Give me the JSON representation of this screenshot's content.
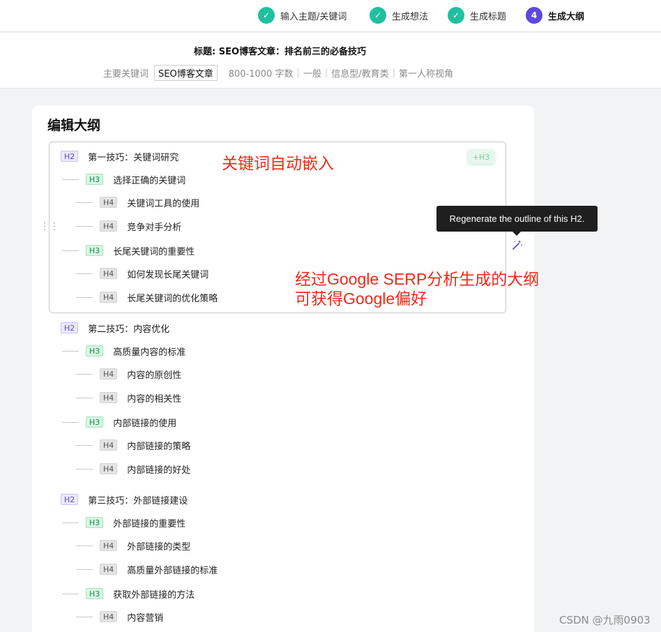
{
  "stepper": {
    "steps": [
      {
        "label": "输入主题/关键词",
        "status": "done",
        "mark": "✓"
      },
      {
        "label": "生成想法",
        "status": "done",
        "mark": "✓"
      },
      {
        "label": "生成标题",
        "status": "done",
        "mark": "✓"
      },
      {
        "label": "生成大纲",
        "status": "active",
        "mark": "4"
      }
    ]
  },
  "info": {
    "title": "标题: SEO博客文章：排名前三的必备技巧",
    "keyword_label": "主要关键词",
    "keyword_value": "SEO博客文章",
    "word_count": "800-1000 字数",
    "tone": "一般",
    "type": "信息型/教育类",
    "perspective": "第一人称视角"
  },
  "card": {
    "title": "编辑大纲",
    "add_h3_label": "+H3",
    "drag_handle": "⋮⋮",
    "tooltip": "Regenerate the outline of this H2."
  },
  "outline": [
    {
      "level": "H2",
      "text": "第一技巧：关键词研究"
    },
    {
      "level": "H3",
      "text": "选择正确的关键词"
    },
    {
      "level": "H4",
      "text": "关键词工具的使用"
    },
    {
      "level": "H4",
      "text": "竞争对手分析"
    },
    {
      "level": "H3",
      "text": "长尾关键词的重要性"
    },
    {
      "level": "H4",
      "text": "如何发现长尾关键词"
    },
    {
      "level": "H4",
      "text": "长尾关键词的优化策略"
    },
    {
      "level": "H2",
      "text": "第二技巧：内容优化"
    },
    {
      "level": "H3",
      "text": "高质量内容的标准"
    },
    {
      "level": "H4",
      "text": "内容的原创性"
    },
    {
      "level": "H4",
      "text": "内容的相关性"
    },
    {
      "level": "H3",
      "text": "内部链接的使用"
    },
    {
      "level": "H4",
      "text": "内部链接的策略"
    },
    {
      "level": "H4",
      "text": "内部链接的好处"
    },
    {
      "level": "H2",
      "text": "第三技巧：外部链接建设"
    },
    {
      "level": "H3",
      "text": "外部链接的重要性"
    },
    {
      "level": "H4",
      "text": "外部链接的类型"
    },
    {
      "level": "H4",
      "text": "高质量外部链接的标准"
    },
    {
      "level": "H3",
      "text": "获取外部链接的方法"
    },
    {
      "level": "H4",
      "text": "内容营销"
    }
  ],
  "annotations": {
    "note1": "关键词自动嵌入",
    "note2_line1": "经过Google SERP分析生成的大纲",
    "note2_line2": "可获得Google偏好"
  },
  "watermark": "CSDN @九雨0903",
  "colors": {
    "done": "#1fc0a0",
    "active": "#5b49e0",
    "annotation": "#ec2b1a"
  }
}
